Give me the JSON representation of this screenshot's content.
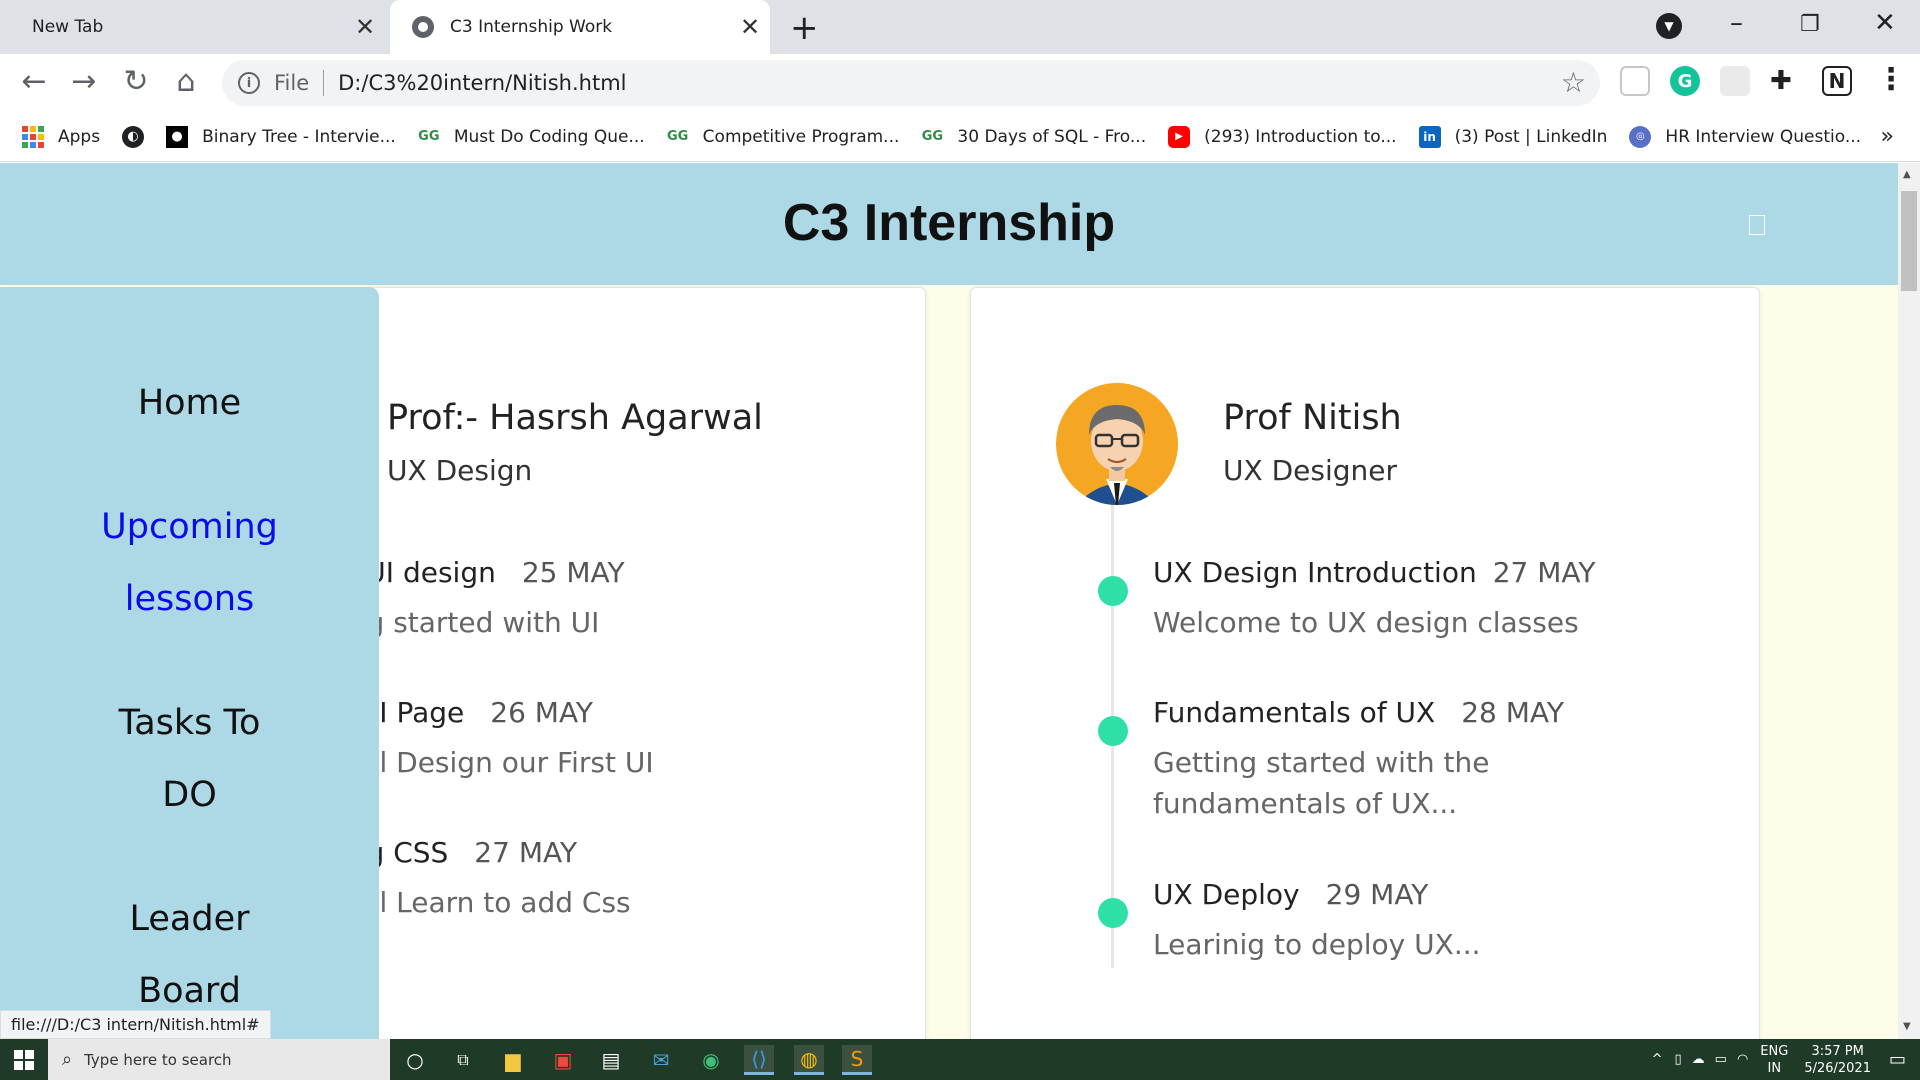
{
  "browser": {
    "tabs": [
      {
        "label": "New Tab",
        "active": false
      },
      {
        "label": "C3 Internship Work",
        "active": true
      }
    ],
    "address": {
      "scheme_label": "File",
      "url": "D:/C3%20intern/Nitish.html"
    },
    "bookmarks": [
      {
        "label": "Apps",
        "icon": "apps-grid-icon"
      },
      {
        "label": "",
        "icon": "globe-icon"
      },
      {
        "label": "Binary Tree - Intervie...",
        "icon": "medium-icon"
      },
      {
        "label": "Must Do Coding Que...",
        "icon": "geeksforgeeks-icon"
      },
      {
        "label": "Competitive Program...",
        "icon": "geeksforgeeks-icon"
      },
      {
        "label": "30 Days of SQL - Fro...",
        "icon": "geeksforgeeks-icon"
      },
      {
        "label": "(293) Introduction to...",
        "icon": "youtube-icon"
      },
      {
        "label": "(3) Post | LinkedIn",
        "icon": "linkedin-icon"
      },
      {
        "label": "HR Interview Questio...",
        "icon": "site-icon"
      }
    ],
    "status_url": "file:///D:/C3 intern/Nitish.html#"
  },
  "page": {
    "site_title": "C3 Internship",
    "sidebar": {
      "items": [
        "Home",
        "Upcoming lessons",
        "Tasks To DO",
        "Leader Board"
      ],
      "active": "Upcoming lessons"
    },
    "cards": [
      {
        "prof_name": "Prof:- Hasrsh Agarwal",
        "role": "UX Design",
        "lessons": [
          {
            "title": "c UI design",
            "date": "25 MAY",
            "desc": "ing started with UI"
          },
          {
            "title": ". UI Page",
            "date": "26 MAY",
            "desc": "will Design our First UI"
          },
          {
            "title": "ing CSS",
            "date": "27 MAY",
            "desc": "will Learn to add Css"
          }
        ]
      },
      {
        "prof_name": "Prof Nitish",
        "role": "UX Designer",
        "lessons": [
          {
            "title": "UX Design Introduction",
            "date": "27 MAY",
            "desc": "Welcome to UX design classes"
          },
          {
            "title": "Fundamentals of UX",
            "date": "28 MAY",
            "desc": "Getting started with the fundamentals of UX..."
          },
          {
            "title": "UX Deploy",
            "date": "29 MAY",
            "desc": "Learinig to deploy UX..."
          }
        ]
      }
    ]
  },
  "taskbar": {
    "search_placeholder": "Type here to search",
    "lang_line1": "ENG",
    "lang_line2": "IN",
    "time": "3:57 PM",
    "date": "5/26/2021"
  },
  "colors": {
    "header_bg": "#add8e6",
    "accent_dot": "#2ee0a8",
    "link_active": "#0b0bea"
  }
}
